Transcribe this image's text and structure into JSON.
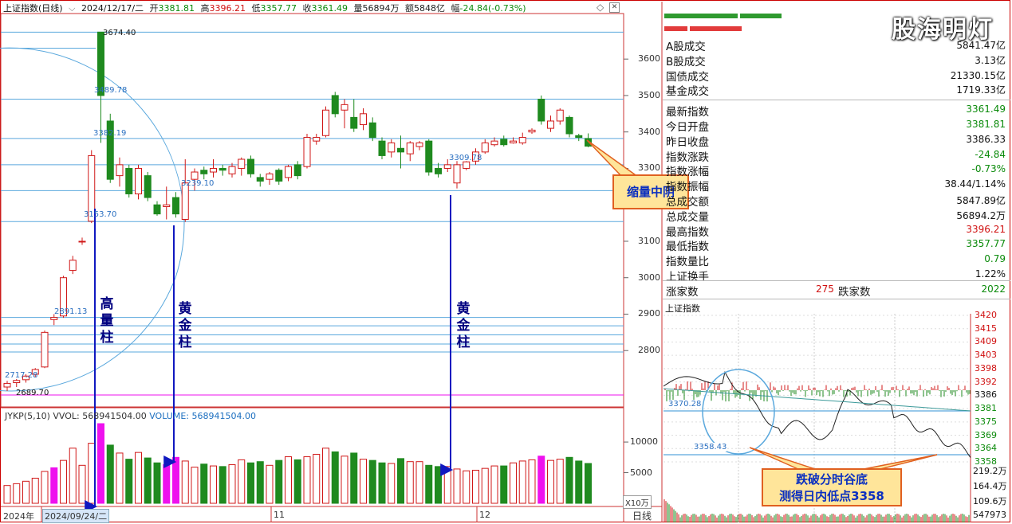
{
  "header": {
    "title": "上证指数(日线)",
    "date": "2024/12/17/二",
    "open_label": "开",
    "open": "3381.81",
    "high_label": "高",
    "high": "3396.21",
    "low_label": "低",
    "low": "3357.77",
    "close_label": "收",
    "close": "3361.49",
    "volume_label": "量",
    "volume": "56894万",
    "amount_label": "额",
    "amount": "5848亿",
    "change_label": "幅",
    "change": "-24.84(-0.73%)"
  },
  "chart_data": {
    "type": "candlestick",
    "yaxis_ticks": [
      2800,
      2900,
      3000,
      3100,
      3200,
      3300,
      3400,
      3500,
      3600
    ],
    "ylim": [
      2665,
      3690
    ],
    "price_labels": [
      "3674.40",
      "3489.78",
      "3382.19",
      "3309.78",
      "3239.10",
      "3153.70",
      "2891.13",
      "2717.28",
      "2689.70"
    ],
    "candles": [
      {
        "o": 2700,
        "c": 2710,
        "h": 2717,
        "l": 2689,
        "up": true
      },
      {
        "o": 2712,
        "c": 2718,
        "h": 2722,
        "l": 2700,
        "up": true
      },
      {
        "o": 2720,
        "c": 2730,
        "h": 2735,
        "l": 2712,
        "up": true
      },
      {
        "o": 2735,
        "c": 2748,
        "h": 2752,
        "l": 2728,
        "up": true
      },
      {
        "o": 2755,
        "c": 2850,
        "h": 2855,
        "l": 2752,
        "up": true
      },
      {
        "o": 2885,
        "c": 2891,
        "h": 2900,
        "l": 2870,
        "up": true
      },
      {
        "o": 2895,
        "c": 3000,
        "h": 3005,
        "l": 2890,
        "up": true
      },
      {
        "o": 3020,
        "c": 3048,
        "h": 3060,
        "l": 3010,
        "up": true
      },
      {
        "o": 3100,
        "c": 3100,
        "h": 3110,
        "l": 3090,
        "up": true
      },
      {
        "o": 3155,
        "c": 3335,
        "h": 3350,
        "l": 3150,
        "up": true
      },
      {
        "o": 3500,
        "c": 3674,
        "h": 3674,
        "l": 3370,
        "up": false
      },
      {
        "o": 3430,
        "c": 3270,
        "h": 3450,
        "l": 3260,
        "up": false
      },
      {
        "o": 3280,
        "c": 3310,
        "h": 3330,
        "l": 3250,
        "up": true
      },
      {
        "o": 3300,
        "c": 3230,
        "h": 3310,
        "l": 3220,
        "up": false
      },
      {
        "o": 3230,
        "c": 3300,
        "h": 3310,
        "l": 3215,
        "up": true
      },
      {
        "o": 3280,
        "c": 3220,
        "h": 3290,
        "l": 3210,
        "up": false
      },
      {
        "o": 3200,
        "c": 3175,
        "h": 3210,
        "l": 3170,
        "up": false
      },
      {
        "o": 3195,
        "c": 3200,
        "h": 3250,
        "l": 3160,
        "up": true
      },
      {
        "o": 3220,
        "c": 3175,
        "h": 3235,
        "l": 3165,
        "up": false
      },
      {
        "o": 3160,
        "c": 3260,
        "h": 3325,
        "l": 3153,
        "up": true
      },
      {
        "o": 3270,
        "c": 3290,
        "h": 3300,
        "l": 3239,
        "up": true
      },
      {
        "o": 3295,
        "c": 3285,
        "h": 3305,
        "l": 3270,
        "up": false
      },
      {
        "o": 3290,
        "c": 3300,
        "h": 3325,
        "l": 3275,
        "up": true
      },
      {
        "o": 3300,
        "c": 3295,
        "h": 3310,
        "l": 3280,
        "up": false
      },
      {
        "o": 3285,
        "c": 3305,
        "h": 3315,
        "l": 3275,
        "up": true
      },
      {
        "o": 3300,
        "c": 3325,
        "h": 3330,
        "l": 3280,
        "up": true
      },
      {
        "o": 3325,
        "c": 3285,
        "h": 3335,
        "l": 3275,
        "up": false
      },
      {
        "o": 3275,
        "c": 3265,
        "h": 3285,
        "l": 3250,
        "up": false
      },
      {
        "o": 3270,
        "c": 3285,
        "h": 3290,
        "l": 3255,
        "up": true
      },
      {
        "o": 3295,
        "c": 3265,
        "h": 3300,
        "l": 3255,
        "up": false
      },
      {
        "o": 3275,
        "c": 3305,
        "h": 3310,
        "l": 3265,
        "up": true
      },
      {
        "o": 3310,
        "c": 3280,
        "h": 3320,
        "l": 3270,
        "up": false
      },
      {
        "o": 3305,
        "c": 3385,
        "h": 3395,
        "l": 3300,
        "up": true
      },
      {
        "o": 3375,
        "c": 3385,
        "h": 3395,
        "l": 3365,
        "up": true
      },
      {
        "o": 3390,
        "c": 3460,
        "h": 3470,
        "l": 3385,
        "up": true
      },
      {
        "o": 3500,
        "c": 3450,
        "h": 3510,
        "l": 3440,
        "up": false
      },
      {
        "o": 3460,
        "c": 3475,
        "h": 3490,
        "l": 3410,
        "up": true
      },
      {
        "o": 3440,
        "c": 3410,
        "h": 3490,
        "l": 3400,
        "up": false
      },
      {
        "o": 3420,
        "c": 3450,
        "h": 3465,
        "l": 3405,
        "up": true
      },
      {
        "o": 3425,
        "c": 3385,
        "h": 3440,
        "l": 3375,
        "up": false
      },
      {
        "o": 3375,
        "c": 3335,
        "h": 3385,
        "l": 3325,
        "up": false
      },
      {
        "o": 3345,
        "c": 3370,
        "h": 3380,
        "l": 3330,
        "up": true
      },
      {
        "o": 3355,
        "c": 3345,
        "h": 3390,
        "l": 3300,
        "up": false
      },
      {
        "o": 3340,
        "c": 3370,
        "h": 3375,
        "l": 3320,
        "up": true
      },
      {
        "o": 3360,
        "c": 3370,
        "h": 3375,
        "l": 3350,
        "up": true
      },
      {
        "o": 3375,
        "c": 3290,
        "h": 3380,
        "l": 3280,
        "up": false
      },
      {
        "o": 3300,
        "c": 3285,
        "h": 3315,
        "l": 3275,
        "up": false
      },
      {
        "o": 3300,
        "c": 3310,
        "h": 3325,
        "l": 3290,
        "up": true
      },
      {
        "o": 3260,
        "c": 3310,
        "h": 3320,
        "l": 3245,
        "up": true
      },
      {
        "o": 3300,
        "c": 3318,
        "h": 3320,
        "l": 3295,
        "up": true
      },
      {
        "o": 3320,
        "c": 3345,
        "h": 3355,
        "l": 3310,
        "up": true
      },
      {
        "o": 3345,
        "c": 3370,
        "h": 3380,
        "l": 3340,
        "up": true
      },
      {
        "o": 3365,
        "c": 3375,
        "h": 3385,
        "l": 3360,
        "up": true
      },
      {
        "o": 3380,
        "c": 3365,
        "h": 3390,
        "l": 3360,
        "up": false
      },
      {
        "o": 3370,
        "c": 3375,
        "h": 3385,
        "l": 3368,
        "up": true
      },
      {
        "o": 3370,
        "c": 3385,
        "h": 3398,
        "l": 3365,
        "up": true
      },
      {
        "o": 3400,
        "c": 3405,
        "h": 3410,
        "l": 3395,
        "up": true
      },
      {
        "o": 3490,
        "c": 3430,
        "h": 3500,
        "l": 3420,
        "up": false
      },
      {
        "o": 3410,
        "c": 3430,
        "h": 3445,
        "l": 3400,
        "up": true
      },
      {
        "o": 3430,
        "c": 3460,
        "h": 3465,
        "l": 3420,
        "up": true
      },
      {
        "o": 3440,
        "c": 3395,
        "h": 3445,
        "l": 3385,
        "up": false
      },
      {
        "o": 3390,
        "c": 3385,
        "h": 3395,
        "l": 3375,
        "up": false
      },
      {
        "o": 3382,
        "c": 3361,
        "h": 3396,
        "l": 3358,
        "up": false
      }
    ],
    "volume_ticks": [
      5000,
      10000
    ],
    "volume_unit": "X10万",
    "volumes": [
      2900,
      3200,
      3600,
      4100,
      5200,
      5800,
      7000,
      9000,
      6200,
      9800,
      13000,
      9500,
      8200,
      7200,
      8300,
      7400,
      6600,
      6300,
      7500,
      6900,
      5900,
      6400,
      6100,
      6000,
      6300,
      7100,
      6600,
      6800,
      6200,
      7000,
      7600,
      7100,
      7600,
      8000,
      9000,
      8400,
      7700,
      8200,
      7200,
      7000,
      6600,
      6500,
      7300,
      6800,
      6800,
      6200,
      6000,
      6000,
      5600,
      5300,
      5400,
      5700,
      6100,
      6100,
      6600,
      6900,
      7100,
      7700,
      7000,
      7200,
      7500,
      6900,
      6500
    ],
    "volume_title": "JYKP(5,10)",
    "volume_vol": "VVOL: 568941504.00",
    "volume_volume": "VOLUME: 568941504.00",
    "x_labels": [
      "2024年",
      "2024/09/24/二",
      "11",
      "12",
      "日线"
    ]
  },
  "annotations": {
    "high_volume": "高量柱",
    "golden1": "黄金柱",
    "golden2": "黄金柱",
    "callout1": "缩量中阴",
    "callout2_line1": "跌破分时谷底",
    "callout2_line2": "测得日内低点3358"
  },
  "watermark": "股海明灯",
  "panel": {
    "rows": [
      {
        "label": "A股成交",
        "value": "5841.47亿",
        "color": "#111111"
      },
      {
        "label": "B股成交",
        "value": "3.13亿",
        "color": "#111111"
      },
      {
        "label": "国债成交",
        "value": "21330.15亿",
        "color": "#111111"
      },
      {
        "label": "基金成交",
        "value": "1719.33亿",
        "color": "#111111"
      },
      {
        "label": "最新指数",
        "value": "3361.49",
        "color": "#0a8a0a"
      },
      {
        "label": "今日开盘",
        "value": "3381.81",
        "color": "#0a8a0a"
      },
      {
        "label": "昨日收盘",
        "value": "3386.33",
        "color": "#111111"
      },
      {
        "label": "指数涨跌",
        "value": "-24.84",
        "color": "#0a8a0a"
      },
      {
        "label": "指数涨幅",
        "value": "-0.73%",
        "color": "#0a8a0a"
      },
      {
        "label": "指数振幅",
        "value": "38.44/1.14%",
        "color": "#111111"
      },
      {
        "label": "总成交额",
        "value": "5847.89亿",
        "color": "#111111"
      },
      {
        "label": "总成交量",
        "value": "56894.2万",
        "color": "#111111"
      },
      {
        "label": "最高指数",
        "value": "3396.21",
        "color": "#d01010"
      },
      {
        "label": "最低指数",
        "value": "3357.77",
        "color": "#0a8a0a"
      },
      {
        "label": "指数量比",
        "value": "0.79",
        "color": "#0a8a0a"
      },
      {
        "label": "上证换手",
        "value": "1.22%",
        "color": "#111111"
      }
    ],
    "rise_label": "涨家数",
    "rise_count": "275",
    "fall_label": "跌家数",
    "fall_count": "2022"
  },
  "mini_chart": {
    "title": "上证指数",
    "price_ticks": [
      "3420",
      "3415",
      "3409",
      "3403",
      "3398",
      "3392",
      "3386",
      "3381",
      "3375",
      "3369",
      "3364",
      "3358"
    ],
    "volume_ticks": [
      "219.2万",
      "164.4万",
      "109.6万",
      "547973"
    ],
    "left_labels": [
      "3370.28",
      "3358.43"
    ]
  },
  "colors": {
    "up": "#d01818",
    "down": "#1f8a1f",
    "magenta": "#ee11ee",
    "hline": "#5aa8dd",
    "arrow": "#1018c0",
    "callout_fill": "#ffe59a",
    "callout_border": "#e06020"
  }
}
